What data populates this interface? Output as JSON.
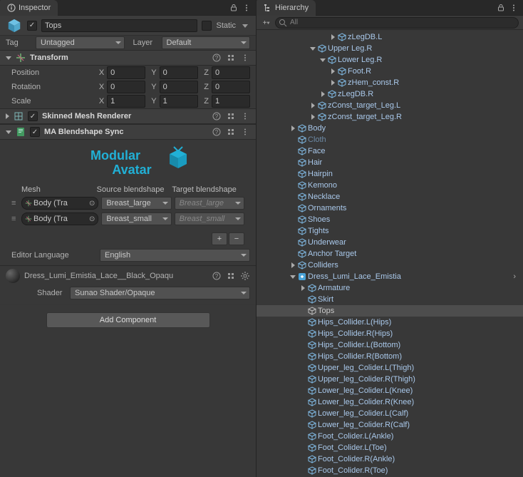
{
  "inspector": {
    "tab_title": "Inspector",
    "go_name": "Tops",
    "static_label": "Static",
    "tag_label": "Tag",
    "tag_value": "Untagged",
    "layer_label": "Layer",
    "layer_value": "Default",
    "transform": {
      "title": "Transform",
      "position_label": "Position",
      "rotation_label": "Rotation",
      "scale_label": "Scale",
      "pos": {
        "x": "0",
        "y": "0",
        "z": "0"
      },
      "rot": {
        "x": "0",
        "y": "0",
        "z": "0"
      },
      "scl": {
        "x": "1",
        "y": "1",
        "z": "1"
      }
    },
    "smr": {
      "title": "Skinned Mesh Renderer"
    },
    "blendshape": {
      "title": "MA Blendshape Sync",
      "logo_text_1": "Modular",
      "logo_text_2": "Avatar",
      "columns": {
        "mesh": "Mesh",
        "source": "Source blendshape",
        "target": "Target blendshape"
      },
      "rows": [
        {
          "mesh": "Body (Tra",
          "source": "Breast_large",
          "target": "Breast_large"
        },
        {
          "mesh": "Body (Tra",
          "source": "Breast_small",
          "target": "Breast_small"
        }
      ],
      "editor_lang_label": "Editor Language",
      "editor_lang_value": "English"
    },
    "material": {
      "name": "Dress_Lumi_Emistia_Lace__Black_Opaqu",
      "shader_label": "Shader",
      "shader_value": "Sunao Shader/Opaque"
    },
    "add_component": "Add Component"
  },
  "hierarchy": {
    "tab_title": "Hierarchy",
    "search_placeholder": "All",
    "items": [
      {
        "depth": 7,
        "fold": "closed",
        "label": "zLegDB.L",
        "prefab": true
      },
      {
        "depth": 5,
        "fold": "open",
        "label": "Upper Leg.R",
        "prefab": true
      },
      {
        "depth": 6,
        "fold": "open",
        "label": "Lower Leg.R",
        "prefab": true
      },
      {
        "depth": 7,
        "fold": "closed",
        "label": "Foot.R",
        "prefab": true
      },
      {
        "depth": 7,
        "fold": "closed",
        "label": "zHem_const.R",
        "prefab": true
      },
      {
        "depth": 6,
        "fold": "closed",
        "label": "zLegDB.R",
        "prefab": true
      },
      {
        "depth": 5,
        "fold": "closed",
        "label": "zConst_target_Leg.L",
        "prefab": true
      },
      {
        "depth": 5,
        "fold": "closed",
        "label": "zConst_target_Leg.R",
        "prefab": true
      },
      {
        "depth": 3,
        "fold": "closed",
        "label": "Body",
        "prefab": true
      },
      {
        "depth": 3,
        "fold": "none",
        "label": "Cloth",
        "prefab": true,
        "muted": true
      },
      {
        "depth": 3,
        "fold": "none",
        "label": "Face",
        "prefab": true
      },
      {
        "depth": 3,
        "fold": "none",
        "label": "Hair",
        "prefab": true
      },
      {
        "depth": 3,
        "fold": "none",
        "label": "Hairpin",
        "prefab": true
      },
      {
        "depth": 3,
        "fold": "none",
        "label": "Kemono",
        "prefab": true
      },
      {
        "depth": 3,
        "fold": "none",
        "label": "Necklace",
        "prefab": true
      },
      {
        "depth": 3,
        "fold": "none",
        "label": "Ornaments",
        "prefab": true
      },
      {
        "depth": 3,
        "fold": "none",
        "label": "Shoes",
        "prefab": true
      },
      {
        "depth": 3,
        "fold": "none",
        "label": "Tights",
        "prefab": true
      },
      {
        "depth": 3,
        "fold": "none",
        "label": "Underwear",
        "prefab": true
      },
      {
        "depth": 3,
        "fold": "none",
        "label": "Anchor Target",
        "prefab": true
      },
      {
        "depth": 3,
        "fold": "closed",
        "label": "Colliders",
        "prefab": true
      },
      {
        "depth": 3,
        "fold": "open",
        "label": "Dress_Lumi_Lace_Emistia",
        "prefab": true,
        "special": true,
        "arrow": true
      },
      {
        "depth": 4,
        "fold": "closed",
        "label": "Armature",
        "prefab": true
      },
      {
        "depth": 4,
        "fold": "none",
        "label": "Skirt",
        "prefab": true
      },
      {
        "depth": 4,
        "fold": "none",
        "label": "Tops",
        "prefab": false,
        "selected": true
      },
      {
        "depth": 4,
        "fold": "none",
        "label": "Hips_Collider.L(Hips)",
        "prefab": true
      },
      {
        "depth": 4,
        "fold": "none",
        "label": "Hips_Collider.R(Hips)",
        "prefab": true
      },
      {
        "depth": 4,
        "fold": "none",
        "label": "Hips_Collider.L(Bottom)",
        "prefab": true
      },
      {
        "depth": 4,
        "fold": "none",
        "label": "Hips_Collider.R(Bottom)",
        "prefab": true
      },
      {
        "depth": 4,
        "fold": "none",
        "label": "Upper_leg_Colider.L(Thigh)",
        "prefab": true
      },
      {
        "depth": 4,
        "fold": "none",
        "label": "Upper_leg_Colider.R(Thigh)",
        "prefab": true
      },
      {
        "depth": 4,
        "fold": "none",
        "label": "Lower_leg_Colider.L(Knee)",
        "prefab": true
      },
      {
        "depth": 4,
        "fold": "none",
        "label": "Lower_leg_Colider.R(Knee)",
        "prefab": true
      },
      {
        "depth": 4,
        "fold": "none",
        "label": "Lower_leg_Colider.L(Calf)",
        "prefab": true
      },
      {
        "depth": 4,
        "fold": "none",
        "label": "Lower_leg_Colider.R(Calf)",
        "prefab": true
      },
      {
        "depth": 4,
        "fold": "none",
        "label": "Foot_Colider.L(Ankle)",
        "prefab": true
      },
      {
        "depth": 4,
        "fold": "none",
        "label": "Foot_Colider.L(Toe)",
        "prefab": true
      },
      {
        "depth": 4,
        "fold": "none",
        "label": "Foot_Colider.R(Ankle)",
        "prefab": true
      },
      {
        "depth": 4,
        "fold": "none",
        "label": "Foot_Colider.R(Toe)",
        "prefab": true
      }
    ]
  }
}
